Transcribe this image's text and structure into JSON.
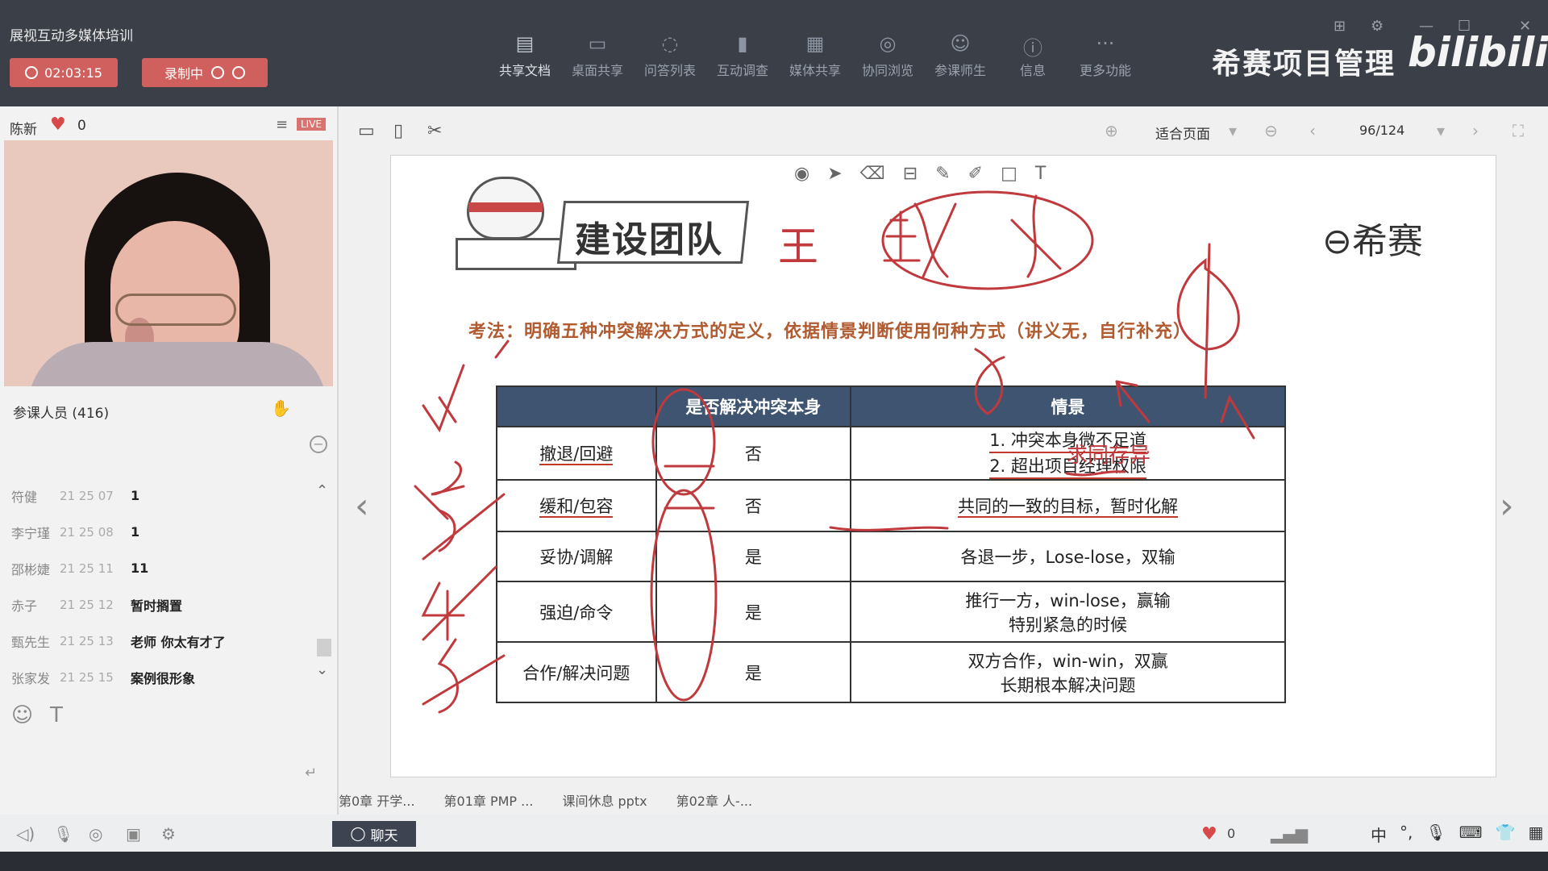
{
  "app": {
    "title": "展视互动多媒体培训",
    "timer": "02:03:15",
    "recording": "录制中",
    "brand": "希赛项目管理",
    "bili": "bilibili"
  },
  "toolbar": [
    {
      "label": "共享文档",
      "icon": "document-icon"
    },
    {
      "label": "桌面共享",
      "icon": "desktop-icon"
    },
    {
      "label": "问答列表",
      "icon": "qa-icon"
    },
    {
      "label": "互动调查",
      "icon": "survey-icon"
    },
    {
      "label": "媒体共享",
      "icon": "media-icon"
    },
    {
      "label": "协同浏览",
      "icon": "compass-icon"
    },
    {
      "label": "参课师生",
      "icon": "people-icon"
    },
    {
      "label": "信息",
      "icon": "info-icon"
    },
    {
      "label": "更多功能",
      "icon": "more-icon"
    }
  ],
  "host": {
    "name": "陈新",
    "likes": "0",
    "live": "LIVE"
  },
  "participants": {
    "title": "参课人员 (416)",
    "messages": [
      {
        "name": "符健",
        "time": "21 25 07",
        "text": "1"
      },
      {
        "name": "李宁瑾",
        "time": "21 25 08",
        "text": "1"
      },
      {
        "name": "邵彬婕",
        "time": "21 25 11",
        "text": "11"
      },
      {
        "name": "赤子",
        "time": "21 25 12",
        "text": "暂时搁置"
      },
      {
        "name": "甄先生",
        "time": "21 25 13",
        "text": "老师  你太有才了"
      },
      {
        "name": "张家发",
        "time": "21 25 15",
        "text": "案例很形象"
      }
    ]
  },
  "viewer": {
    "fit": "适合页面",
    "page": "96/124"
  },
  "slide": {
    "title": "建设团队",
    "logo": "希赛",
    "exam_note": "考法：明确五种冲突解决方式的定义，依据情景判断使用何种方式（讲义无，自行补充）",
    "headers": [
      "",
      "是否解决冲突本身",
      "情景"
    ],
    "rows": [
      {
        "method": "撤退/回避",
        "resolves": "否",
        "scene1": "1.  冲突本身微不足道",
        "scene2": "2.  超出项目经理权限"
      },
      {
        "method": "缓和/包容",
        "resolves": "否",
        "scene1": "共同的一致的目标，暂时化解",
        "scene2": ""
      },
      {
        "method": "妥协/调解",
        "resolves": "是",
        "scene1": "各退一步，Lose-lose，双输",
        "scene2": ""
      },
      {
        "method": "强迫/命令",
        "resolves": "是",
        "scene1": "推行一方，win-lose，赢输",
        "scene2": "特别紧急的时候"
      },
      {
        "method": "合作/解决问题",
        "resolves": "是",
        "scene1": "双方合作，win-win，双赢",
        "scene2": "长期根本解决问题"
      }
    ],
    "handwritten": {
      "side_note": "求同存异",
      "left_word": "王"
    }
  },
  "tabs": [
    "第0章 开学...",
    "第01章 PMP ...",
    "课间休息 pptx",
    "第02章 人-..."
  ],
  "bottom": {
    "chat": "聊天",
    "likes": "0",
    "ime": "中"
  }
}
